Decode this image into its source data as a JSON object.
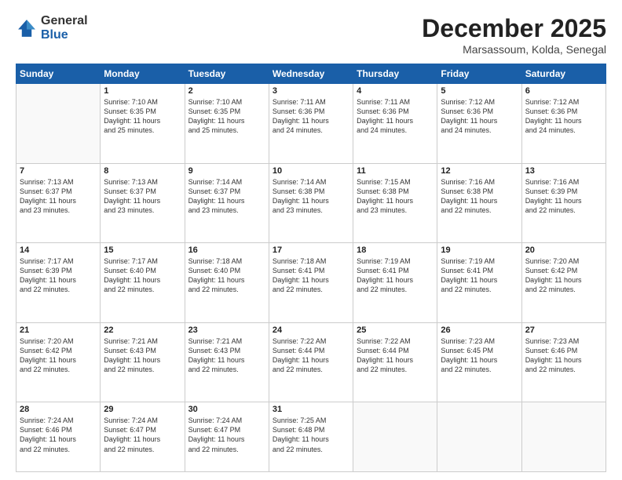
{
  "logo": {
    "general": "General",
    "blue": "Blue"
  },
  "title": "December 2025",
  "location": "Marsassoum, Kolda, Senegal",
  "days": [
    "Sunday",
    "Monday",
    "Tuesday",
    "Wednesday",
    "Thursday",
    "Friday",
    "Saturday"
  ],
  "weeks": [
    [
      {
        "day": "",
        "info": ""
      },
      {
        "day": "1",
        "info": "Sunrise: 7:10 AM\nSunset: 6:35 PM\nDaylight: 11 hours\nand 25 minutes."
      },
      {
        "day": "2",
        "info": "Sunrise: 7:10 AM\nSunset: 6:35 PM\nDaylight: 11 hours\nand 25 minutes."
      },
      {
        "day": "3",
        "info": "Sunrise: 7:11 AM\nSunset: 6:36 PM\nDaylight: 11 hours\nand 24 minutes."
      },
      {
        "day": "4",
        "info": "Sunrise: 7:11 AM\nSunset: 6:36 PM\nDaylight: 11 hours\nand 24 minutes."
      },
      {
        "day": "5",
        "info": "Sunrise: 7:12 AM\nSunset: 6:36 PM\nDaylight: 11 hours\nand 24 minutes."
      },
      {
        "day": "6",
        "info": "Sunrise: 7:12 AM\nSunset: 6:36 PM\nDaylight: 11 hours\nand 24 minutes."
      }
    ],
    [
      {
        "day": "7",
        "info": "Sunrise: 7:13 AM\nSunset: 6:37 PM\nDaylight: 11 hours\nand 23 minutes."
      },
      {
        "day": "8",
        "info": "Sunrise: 7:13 AM\nSunset: 6:37 PM\nDaylight: 11 hours\nand 23 minutes."
      },
      {
        "day": "9",
        "info": "Sunrise: 7:14 AM\nSunset: 6:37 PM\nDaylight: 11 hours\nand 23 minutes."
      },
      {
        "day": "10",
        "info": "Sunrise: 7:14 AM\nSunset: 6:38 PM\nDaylight: 11 hours\nand 23 minutes."
      },
      {
        "day": "11",
        "info": "Sunrise: 7:15 AM\nSunset: 6:38 PM\nDaylight: 11 hours\nand 23 minutes."
      },
      {
        "day": "12",
        "info": "Sunrise: 7:16 AM\nSunset: 6:38 PM\nDaylight: 11 hours\nand 22 minutes."
      },
      {
        "day": "13",
        "info": "Sunrise: 7:16 AM\nSunset: 6:39 PM\nDaylight: 11 hours\nand 22 minutes."
      }
    ],
    [
      {
        "day": "14",
        "info": "Sunrise: 7:17 AM\nSunset: 6:39 PM\nDaylight: 11 hours\nand 22 minutes."
      },
      {
        "day": "15",
        "info": "Sunrise: 7:17 AM\nSunset: 6:40 PM\nDaylight: 11 hours\nand 22 minutes."
      },
      {
        "day": "16",
        "info": "Sunrise: 7:18 AM\nSunset: 6:40 PM\nDaylight: 11 hours\nand 22 minutes."
      },
      {
        "day": "17",
        "info": "Sunrise: 7:18 AM\nSunset: 6:41 PM\nDaylight: 11 hours\nand 22 minutes."
      },
      {
        "day": "18",
        "info": "Sunrise: 7:19 AM\nSunset: 6:41 PM\nDaylight: 11 hours\nand 22 minutes."
      },
      {
        "day": "19",
        "info": "Sunrise: 7:19 AM\nSunset: 6:41 PM\nDaylight: 11 hours\nand 22 minutes."
      },
      {
        "day": "20",
        "info": "Sunrise: 7:20 AM\nSunset: 6:42 PM\nDaylight: 11 hours\nand 22 minutes."
      }
    ],
    [
      {
        "day": "21",
        "info": "Sunrise: 7:20 AM\nSunset: 6:42 PM\nDaylight: 11 hours\nand 22 minutes."
      },
      {
        "day": "22",
        "info": "Sunrise: 7:21 AM\nSunset: 6:43 PM\nDaylight: 11 hours\nand 22 minutes."
      },
      {
        "day": "23",
        "info": "Sunrise: 7:21 AM\nSunset: 6:43 PM\nDaylight: 11 hours\nand 22 minutes."
      },
      {
        "day": "24",
        "info": "Sunrise: 7:22 AM\nSunset: 6:44 PM\nDaylight: 11 hours\nand 22 minutes."
      },
      {
        "day": "25",
        "info": "Sunrise: 7:22 AM\nSunset: 6:44 PM\nDaylight: 11 hours\nand 22 minutes."
      },
      {
        "day": "26",
        "info": "Sunrise: 7:23 AM\nSunset: 6:45 PM\nDaylight: 11 hours\nand 22 minutes."
      },
      {
        "day": "27",
        "info": "Sunrise: 7:23 AM\nSunset: 6:46 PM\nDaylight: 11 hours\nand 22 minutes."
      }
    ],
    [
      {
        "day": "28",
        "info": "Sunrise: 7:24 AM\nSunset: 6:46 PM\nDaylight: 11 hours\nand 22 minutes."
      },
      {
        "day": "29",
        "info": "Sunrise: 7:24 AM\nSunset: 6:47 PM\nDaylight: 11 hours\nand 22 minutes."
      },
      {
        "day": "30",
        "info": "Sunrise: 7:24 AM\nSunset: 6:47 PM\nDaylight: 11 hours\nand 22 minutes."
      },
      {
        "day": "31",
        "info": "Sunrise: 7:25 AM\nSunset: 6:48 PM\nDaylight: 11 hours\nand 22 minutes."
      },
      {
        "day": "",
        "info": ""
      },
      {
        "day": "",
        "info": ""
      },
      {
        "day": "",
        "info": ""
      }
    ]
  ]
}
